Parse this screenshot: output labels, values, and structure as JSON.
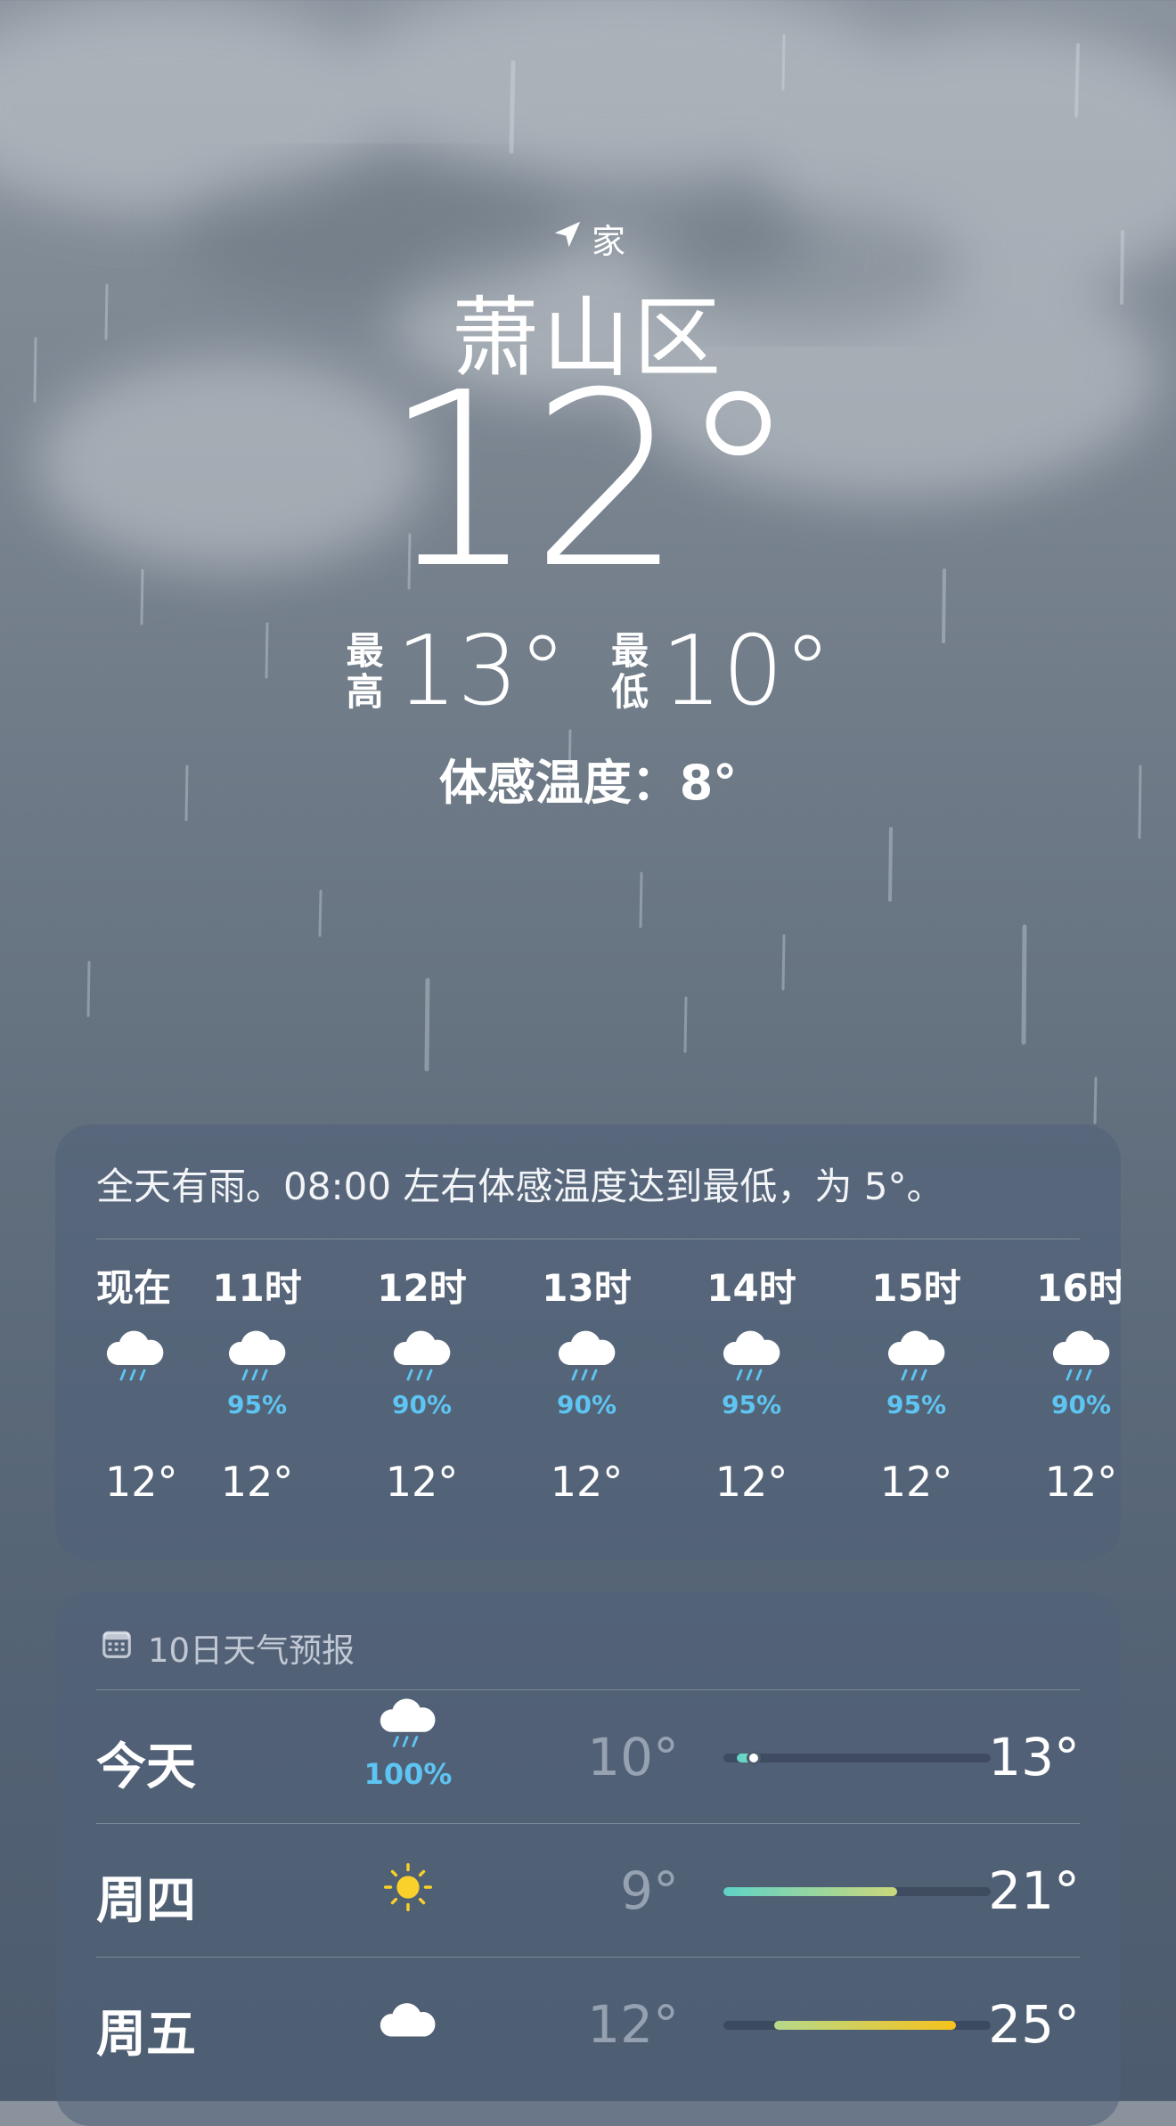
{
  "header": {
    "location_label": "家",
    "city": "萧山区",
    "current_temp": "12°",
    "high_label": "最高",
    "high_value": "13°",
    "low_label": "最低",
    "low_value": "10°",
    "feels_like": "体感温度：8°"
  },
  "hourly": {
    "summary": "全天有雨。08:00 左右体感温度达到最低，为 5°。",
    "items": [
      {
        "time": "现在",
        "icon": "rain-cloud-icon",
        "precip": "",
        "temp": "12°"
      },
      {
        "time": "11时",
        "icon": "rain-cloud-icon",
        "precip": "95%",
        "temp": "12°"
      },
      {
        "time": "12时",
        "icon": "rain-cloud-icon",
        "precip": "90%",
        "temp": "12°"
      },
      {
        "time": "13时",
        "icon": "rain-cloud-icon",
        "precip": "90%",
        "temp": "12°"
      },
      {
        "time": "14时",
        "icon": "rain-cloud-icon",
        "precip": "95%",
        "temp": "12°"
      },
      {
        "time": "15时",
        "icon": "rain-cloud-icon",
        "precip": "95%",
        "temp": "12°"
      },
      {
        "time": "16时",
        "icon": "rain-cloud-icon",
        "precip": "90%",
        "temp": "12°"
      }
    ]
  },
  "forecast": {
    "title": "10日天气预报",
    "days": [
      {
        "name": "今天",
        "icon": "rain-cloud-icon",
        "precip": "100%",
        "low": "10°",
        "high": "13°",
        "range_start": 0.05,
        "range_end": 0.12,
        "color_start": "#5fd3c8",
        "color_end": "#7fdcc4"
      },
      {
        "name": "周四",
        "icon": "sun-icon",
        "precip": "",
        "low": "9°",
        "high": "21°",
        "range_start": 0.0,
        "range_end": 0.65,
        "color_start": "#5fd3c8",
        "color_end": "#cbd87a"
      },
      {
        "name": "周五",
        "icon": "cloud-icon",
        "precip": "",
        "low": "12°",
        "high": "25°",
        "range_start": 0.19,
        "range_end": 0.87,
        "color_start": "#b6d98a",
        "color_end": "#f6c21c"
      }
    ]
  },
  "colors": {
    "precip": "#5ec4f2",
    "sun": "#f9d12a"
  }
}
